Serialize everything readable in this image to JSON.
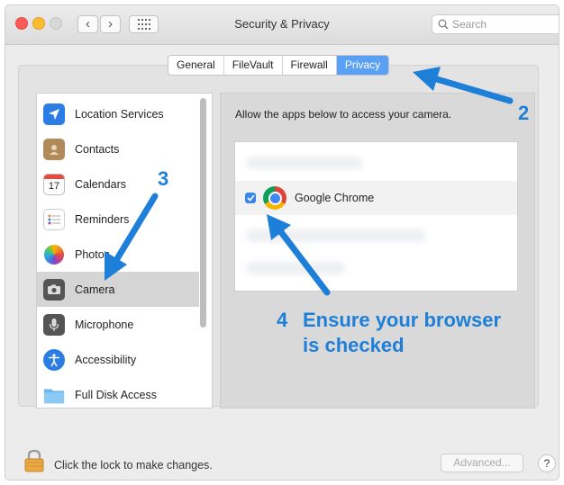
{
  "window": {
    "title": "Security & Privacy"
  },
  "search": {
    "placeholder": "Search"
  },
  "tabs": [
    {
      "label": "General"
    },
    {
      "label": "FileVault"
    },
    {
      "label": "Firewall"
    },
    {
      "label": "Privacy"
    }
  ],
  "sidebar": {
    "items": [
      {
        "label": "Location Services",
        "icon": "location-arrow-icon"
      },
      {
        "label": "Contacts",
        "icon": "contacts-book-icon"
      },
      {
        "label": "Calendars",
        "icon": "calendar-icon",
        "icon_text": "17"
      },
      {
        "label": "Reminders",
        "icon": "reminders-list-icon"
      },
      {
        "label": "Photos",
        "icon": "photos-flower-icon"
      },
      {
        "label": "Camera",
        "icon": "camera-icon",
        "selected": true
      },
      {
        "label": "Microphone",
        "icon": "microphone-icon"
      },
      {
        "label": "Accessibility",
        "icon": "accessibility-icon"
      },
      {
        "label": "Full Disk Access",
        "icon": "folder-icon"
      }
    ]
  },
  "main": {
    "description": "Allow the apps below to access your camera.",
    "apps": [
      {
        "name": "Google Chrome",
        "checked": true,
        "icon": "chrome-icon"
      }
    ]
  },
  "annotations": {
    "step2": "2",
    "step3": "3",
    "step4_number": "4",
    "step4_line1": "Ensure your browser",
    "step4_line2": "is checked"
  },
  "footer": {
    "lock_text": "Click the lock to make changes.",
    "advanced_label": "Advanced...",
    "help_label": "?"
  },
  "colors": {
    "accent": "#5aa0f5",
    "annotation": "#1e7fd9",
    "checkbox": "#3a85e8"
  }
}
